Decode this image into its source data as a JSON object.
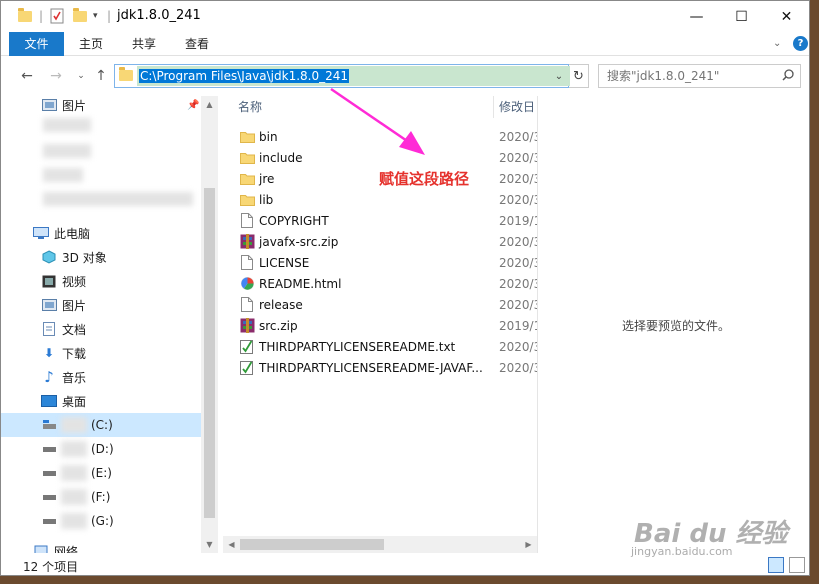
{
  "window": {
    "title": "jdk1.8.0_241",
    "minimize_glyph": "—",
    "maximize_glyph": "☐",
    "close_glyph": "✕"
  },
  "ribbon": {
    "tabs": [
      "文件",
      "主页",
      "共享",
      "查看"
    ]
  },
  "address_bar": {
    "path": "C:\\Program Files\\Java\\jdk1.8.0_241"
  },
  "search": {
    "placeholder": "搜索\"jdk1.8.0_241\""
  },
  "nav_pane": {
    "quick_access_pictures": "图片",
    "this_pc": "此电脑",
    "items": [
      "3D 对象",
      "视频",
      "图片",
      "文档",
      "下载",
      "音乐",
      "桌面"
    ],
    "drives": [
      "(C:)",
      "(D:)",
      "(E:)",
      "(F:)",
      "(G:)"
    ],
    "network": "网络"
  },
  "file_list": {
    "col_name": "名称",
    "col_date": "修改日",
    "files": [
      {
        "name": "bin",
        "date": "2020/3",
        "type": "folder"
      },
      {
        "name": "include",
        "date": "2020/3",
        "type": "folder"
      },
      {
        "name": "jre",
        "date": "2020/3",
        "type": "folder"
      },
      {
        "name": "lib",
        "date": "2020/3",
        "type": "folder"
      },
      {
        "name": "COPYRIGHT",
        "date": "2019/1",
        "type": "file"
      },
      {
        "name": "javafx-src.zip",
        "date": "2020/3",
        "type": "zip"
      },
      {
        "name": "LICENSE",
        "date": "2020/3",
        "type": "file"
      },
      {
        "name": "README.html",
        "date": "2020/3",
        "type": "html"
      },
      {
        "name": "release",
        "date": "2020/3",
        "type": "file"
      },
      {
        "name": "src.zip",
        "date": "2019/1",
        "type": "zip"
      },
      {
        "name": "THIRDPARTYLICENSEREADME.txt",
        "date": "2020/3",
        "type": "txt"
      },
      {
        "name": "THIRDPARTYLICENSEREADME-JAVAF...",
        "date": "2020/3",
        "type": "txt"
      }
    ]
  },
  "preview_pane": {
    "text": "选择要预览的文件。"
  },
  "status_bar": {
    "item_count": "12 个项目"
  },
  "annotation": {
    "text": "赋值这段路径",
    "color": "#e5322d",
    "arrow_color": "#ff2bd6"
  },
  "watermark": {
    "brand": "Bai du 经验",
    "url": "jingyan.baidu.com"
  },
  "colors": {
    "accent": "#1979ca",
    "selection": "#cce8ff"
  }
}
